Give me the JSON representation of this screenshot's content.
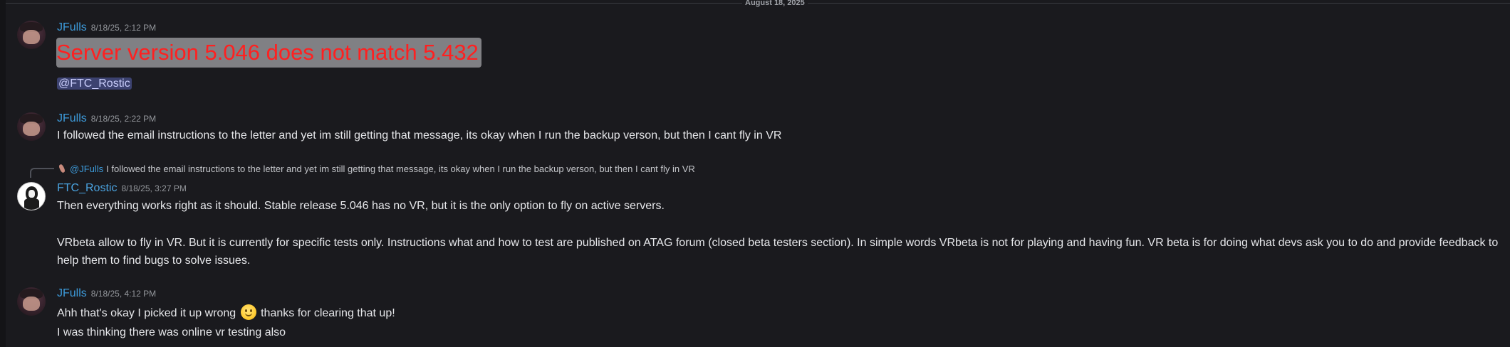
{
  "date_divider": "August 18, 2025",
  "messages": [
    {
      "username": "JFulls",
      "timestamp": "8/18/25, 2:12 PM",
      "highlight_text": "Server version 5.046 does not match 5.432",
      "mention": "@FTC_Rostic"
    },
    {
      "username": "JFulls",
      "timestamp": "8/18/25, 2:22 PM",
      "text": "I followed the email instructions to the letter and yet im still getting that message, its okay when I run the backup verson, but then I cant fly in VR"
    },
    {
      "reply": {
        "username": "@JFulls",
        "text": "I followed the email instructions to the letter and yet im still getting that message, its okay when I run the backup verson, but then I cant fly in VR"
      },
      "username": "FTC_Rostic",
      "timestamp": "8/18/25, 3:27 PM",
      "paragraph1": "Then everything works right as it should. Stable release 5.046 has no VR, but it is the only option to fly on active servers.",
      "paragraph2": "VRbeta allow to fly in VR. But it is currently for specific tests only. Instructions what and how to test are published on ATAG forum (closed beta testers section). In simple words VRbeta is not for playing and having fun. VR beta is for doing what devs ask you to do and provide feedback to help them to find bugs to solve issues."
    },
    {
      "username": "JFulls",
      "timestamp": "8/18/25, 4:12 PM",
      "text_before_emoji": "Ahh that's okay I picked it up wrong",
      "emoji": "slightly-smiling-face",
      "text_after_emoji": "thanks for clearing that up!",
      "text2": "I was thinking there was online vr testing also"
    }
  ]
}
